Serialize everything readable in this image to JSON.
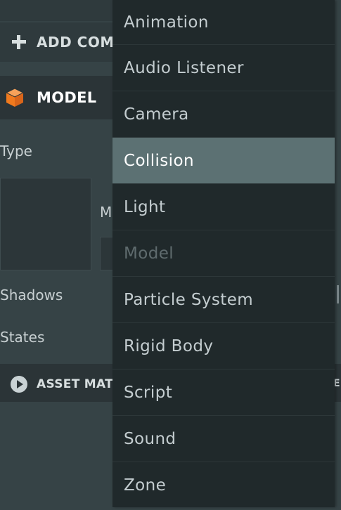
{
  "inspector": {
    "add_component_label": "ADD COM",
    "model_header_label": "MODEL",
    "type_label": "Type",
    "m_label": "M",
    "shadows_label": "Shadows",
    "states_label": "States",
    "asset_section_label": "ASSET MAT",
    "right_edge_char": "E",
    "model_icon_color": "#f07a1e"
  },
  "component_menu": {
    "items": [
      {
        "label": "Animation",
        "state": "normal"
      },
      {
        "label": "Audio Listener",
        "state": "normal"
      },
      {
        "label": "Camera",
        "state": "normal"
      },
      {
        "label": "Collision",
        "state": "selected"
      },
      {
        "label": "Light",
        "state": "normal"
      },
      {
        "label": "Model",
        "state": "disabled"
      },
      {
        "label": "Particle System",
        "state": "normal"
      },
      {
        "label": "Rigid Body",
        "state": "normal"
      },
      {
        "label": "Script",
        "state": "normal"
      },
      {
        "label": "Sound",
        "state": "normal"
      },
      {
        "label": "Zone",
        "state": "normal"
      }
    ],
    "colors": {
      "background": "#20292b",
      "selected": "#5c7173",
      "disabled_text": "#5f6b6e"
    }
  }
}
